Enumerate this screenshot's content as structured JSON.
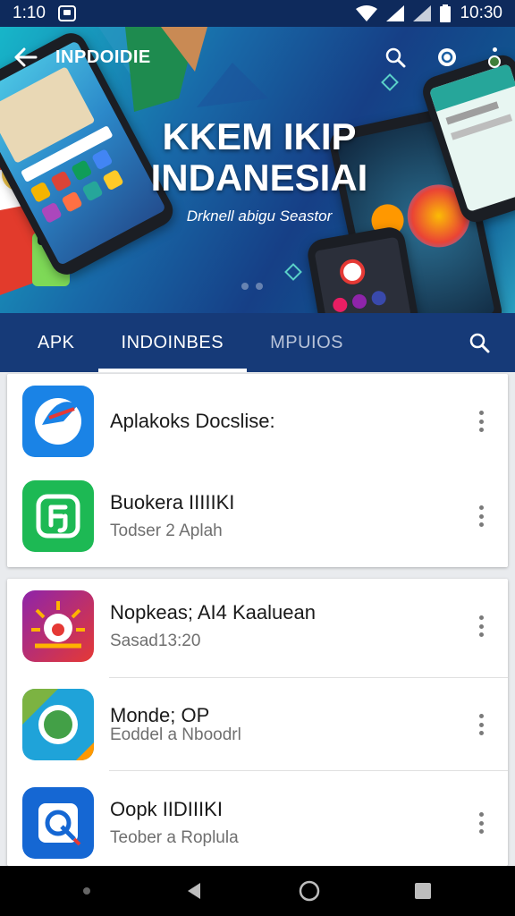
{
  "status_bar": {
    "time_left": "1:10",
    "time_right": "10:30"
  },
  "app_bar": {
    "title": "INPDOIDIE"
  },
  "hero": {
    "title_line1": "KKEM IKIP",
    "title_line2": "INDANESIAI",
    "subtitle": "Drknell abigu Seastor"
  },
  "tabs": [
    {
      "label": "APK",
      "active": false
    },
    {
      "label": "INDOINBES",
      "active": true
    },
    {
      "label": "MPUIOS",
      "active": false
    }
  ],
  "cards": [
    {
      "items": [
        {
          "name": "Aplakoks Docslise:",
          "sub": "",
          "icon": "blue-swirl-icon",
          "color": "#1a83e6"
        },
        {
          "name": "Buokera IIIIIKI",
          "sub": "Todser 2 Aplah",
          "icon": "green-bracket-icon",
          "color": "#1db954"
        }
      ]
    },
    {
      "items": [
        {
          "name": "Nopkeas; AI4 Kaaluean",
          "sub": "Sasad13:20",
          "icon": "sun-burst-icon",
          "color": "#c0185a"
        },
        {
          "name": "Monde; OP",
          "sub": "Eoddel a Nboodrl",
          "icon": "green-circle-icon",
          "color": "#1fa3d9"
        },
        {
          "name": "Oopk IIDIIIKI",
          "sub": "Teober a Roplula",
          "icon": "blue-q-icon",
          "color": "#1567d3"
        }
      ]
    }
  ],
  "colors": {
    "status_bar": "#0e2a5c",
    "tab_bar": "#163a78",
    "accent": "#ffffff"
  }
}
